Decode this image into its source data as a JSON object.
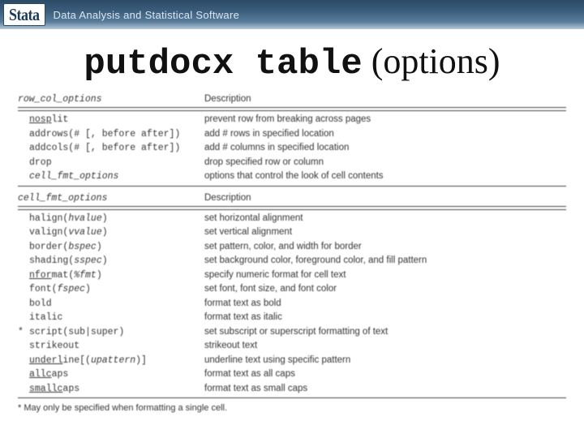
{
  "header": {
    "logo_text": "Stata",
    "tagline": "Data Analysis and Statistical Software"
  },
  "title": {
    "cmd": "putdocx table",
    "suffix": "(options)"
  },
  "sections": [
    {
      "head_col1": "row_col_options",
      "head_col2": "Description",
      "rows": [
        {
          "m": "",
          "opt": "<span class='u'>nosp</span>lit",
          "desc": "prevent row from breaking across pages"
        },
        {
          "m": "",
          "opt": "addrows(# [, before after])",
          "desc": "add # rows in specified location"
        },
        {
          "m": "",
          "opt": "addcols(# [, before after])",
          "desc": "add # columns in specified location"
        },
        {
          "m": "",
          "opt": "drop",
          "desc": "drop specified row or column"
        },
        {
          "m": "",
          "opt": "<span class='em'>cell_fmt_options</span>",
          "desc": "options that control the look of cell contents"
        }
      ]
    },
    {
      "head_col1": "cell_fmt_options",
      "head_col2": "Description",
      "rows": [
        {
          "m": "",
          "opt": "halign(<span class='em'>hvalue</span>)",
          "desc": "set horizontal alignment"
        },
        {
          "m": "",
          "opt": "valign(<span class='em'>vvalue</span>)",
          "desc": "set vertical alignment"
        },
        {
          "m": "",
          "opt": "border(<span class='em'>bspec</span>)",
          "desc": "set pattern, color, and width for border"
        },
        {
          "m": "",
          "opt": "shading(<span class='em'>sspec</span>)",
          "desc": "set background color, foreground color, and fill pattern"
        },
        {
          "m": "",
          "opt": "<span class='u'>nfor</span>mat(<span class='em'>%fmt</span>)",
          "desc": "specify numeric format for cell text"
        },
        {
          "m": "",
          "opt": "font(<span class='em'>fspec</span>)",
          "desc": "set font, font size, and font color"
        },
        {
          "m": "",
          "opt": "bold",
          "desc": "format text as bold"
        },
        {
          "m": "",
          "opt": "italic",
          "desc": "format text as italic"
        },
        {
          "m": "*",
          "opt": "script(sub|super)",
          "desc": "set subscript or superscript formatting of text"
        },
        {
          "m": "",
          "opt": "strikeout",
          "desc": "strikeout text"
        },
        {
          "m": "",
          "opt": "<span class='u'>underl</span>ine[(<span class='em'>upattern</span>)]",
          "desc": "underline text using specific pattern"
        },
        {
          "m": "",
          "opt": "<span class='u'>allc</span>aps",
          "desc": "format text as all caps"
        },
        {
          "m": "",
          "opt": "<span class='u'>smallc</span>aps",
          "desc": "format text as small caps"
        }
      ]
    }
  ],
  "footnote": "* May only be specified when formatting a single cell."
}
